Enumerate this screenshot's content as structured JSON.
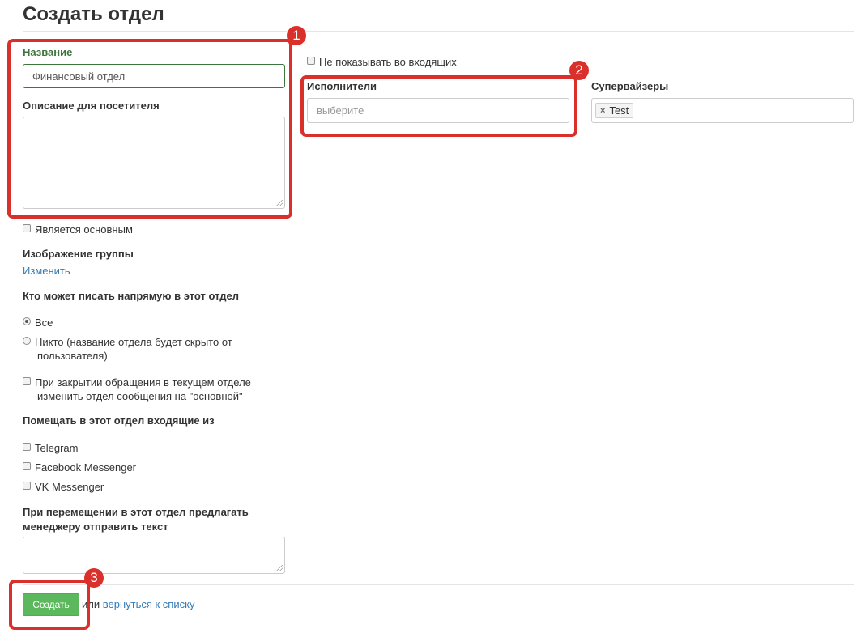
{
  "page": {
    "title": "Создать отдел"
  },
  "name_field": {
    "label": "Название",
    "value": "Финансовый отдел"
  },
  "description_field": {
    "label": "Описание для посетителя",
    "value": ""
  },
  "is_main": {
    "label": "Является основным",
    "checked": false
  },
  "group_image": {
    "label": "Изображение группы",
    "change_link": "Изменить"
  },
  "who_can_write": {
    "label": "Кто может писать напрямую в этот отдел",
    "options": [
      {
        "label": "Все",
        "selected": true
      },
      {
        "label_line1": "Никто (название отдела будет скрыто от",
        "label_line2": "пользователя)",
        "selected": false
      }
    ]
  },
  "on_close": {
    "label_line1": "При закрытии обращения в текущем отделе",
    "label_line2": "изменить отдел сообщения на \"основной\"",
    "checked": false
  },
  "incoming_from": {
    "label": "Помещать в этот отдел входящие из",
    "channels": [
      "Telegram",
      "Facebook Messenger",
      "VK Messenger"
    ]
  },
  "suggest_text": {
    "label_line1": "При перемещении в этот отдел предлагать",
    "label_line2": "менеджеру отправить текст",
    "value": ""
  },
  "hide_incoming": {
    "label": "Не показывать во входящих",
    "checked": false
  },
  "executors": {
    "label": "Исполнители",
    "placeholder": "выберите"
  },
  "supervisors": {
    "label": "Супервайзеры",
    "tags": [
      "Test"
    ]
  },
  "footer": {
    "create_button": "Создать",
    "or_text": "или",
    "back_link": "вернуться к списку"
  },
  "annotations": {
    "badges": [
      "1",
      "2",
      "3"
    ],
    "color": "#d9302c"
  },
  "colors": {
    "primary_button": "#5cb85c",
    "link": "#337ab7",
    "success_label": "#3c763d"
  }
}
